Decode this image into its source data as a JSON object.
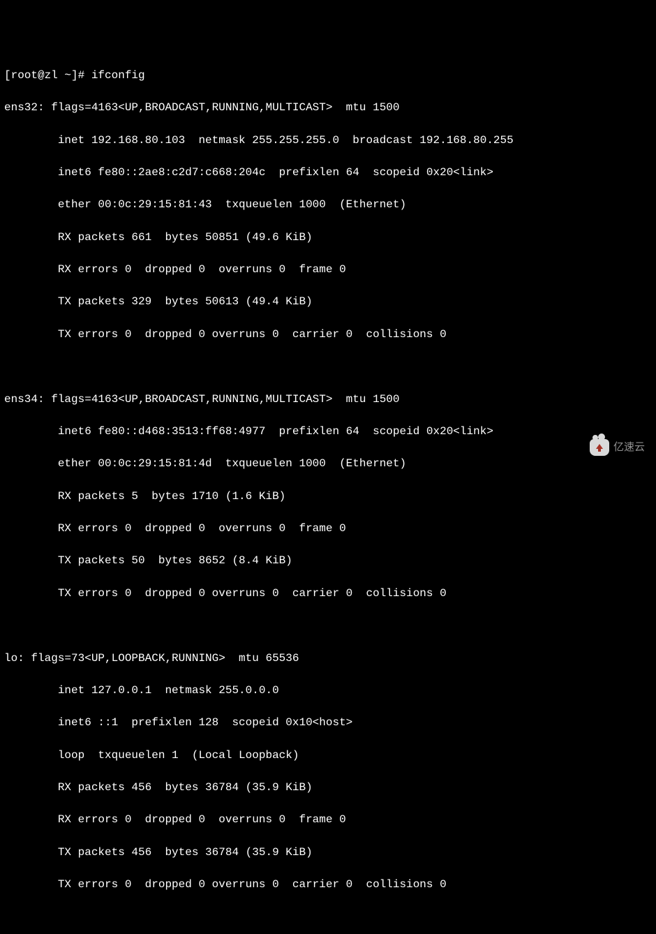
{
  "prompt": "[root@zl ~]# ifconfig",
  "interfaces": {
    "ens32": {
      "header": "ens32: flags=4163<UP,BROADCAST,RUNNING,MULTICAST>  mtu 1500",
      "inet": "        inet 192.168.80.103  netmask 255.255.255.0  broadcast 192.168.80.255",
      "inet6": "        inet6 fe80::2ae8:c2d7:c668:204c  prefixlen 64  scopeid 0x20<link>",
      "ether": "        ether 00:0c:29:15:81:43  txqueuelen 1000  (Ethernet)",
      "rx_packets": "        RX packets 661  bytes 50851 (49.6 KiB)",
      "rx_errors": "        RX errors 0  dropped 0  overruns 0  frame 0",
      "tx_packets": "        TX packets 329  bytes 50613 (49.4 KiB)",
      "tx_errors": "        TX errors 0  dropped 0 overruns 0  carrier 0  collisions 0"
    },
    "ens34": {
      "header": "ens34: flags=4163<UP,BROADCAST,RUNNING,MULTICAST>  mtu 1500",
      "inet6": "        inet6 fe80::d468:3513:ff68:4977  prefixlen 64  scopeid 0x20<link>",
      "ether": "        ether 00:0c:29:15:81:4d  txqueuelen 1000  (Ethernet)",
      "rx_packets": "        RX packets 5  bytes 1710 (1.6 KiB)",
      "rx_errors": "        RX errors 0  dropped 0  overruns 0  frame 0",
      "tx_packets": "        TX packets 50  bytes 8652 (8.4 KiB)",
      "tx_errors": "        TX errors 0  dropped 0 overruns 0  carrier 0  collisions 0"
    },
    "lo": {
      "header": "lo: flags=73<UP,LOOPBACK,RUNNING>  mtu 65536",
      "inet": "        inet 127.0.0.1  netmask 255.0.0.0",
      "inet6": "        inet6 ::1  prefixlen 128  scopeid 0x10<host>",
      "loop": "        loop  txqueuelen 1  (Local Loopback)",
      "rx_packets": "        RX packets 456  bytes 36784 (35.9 KiB)",
      "rx_errors": "        RX errors 0  dropped 0  overruns 0  frame 0",
      "tx_packets": "        TX packets 456  bytes 36784 (35.9 KiB)",
      "tx_errors": "        TX errors 0  dropped 0 overruns 0  carrier 0  collisions 0"
    }
  },
  "blank": " ",
  "watermark": "亿速云"
}
